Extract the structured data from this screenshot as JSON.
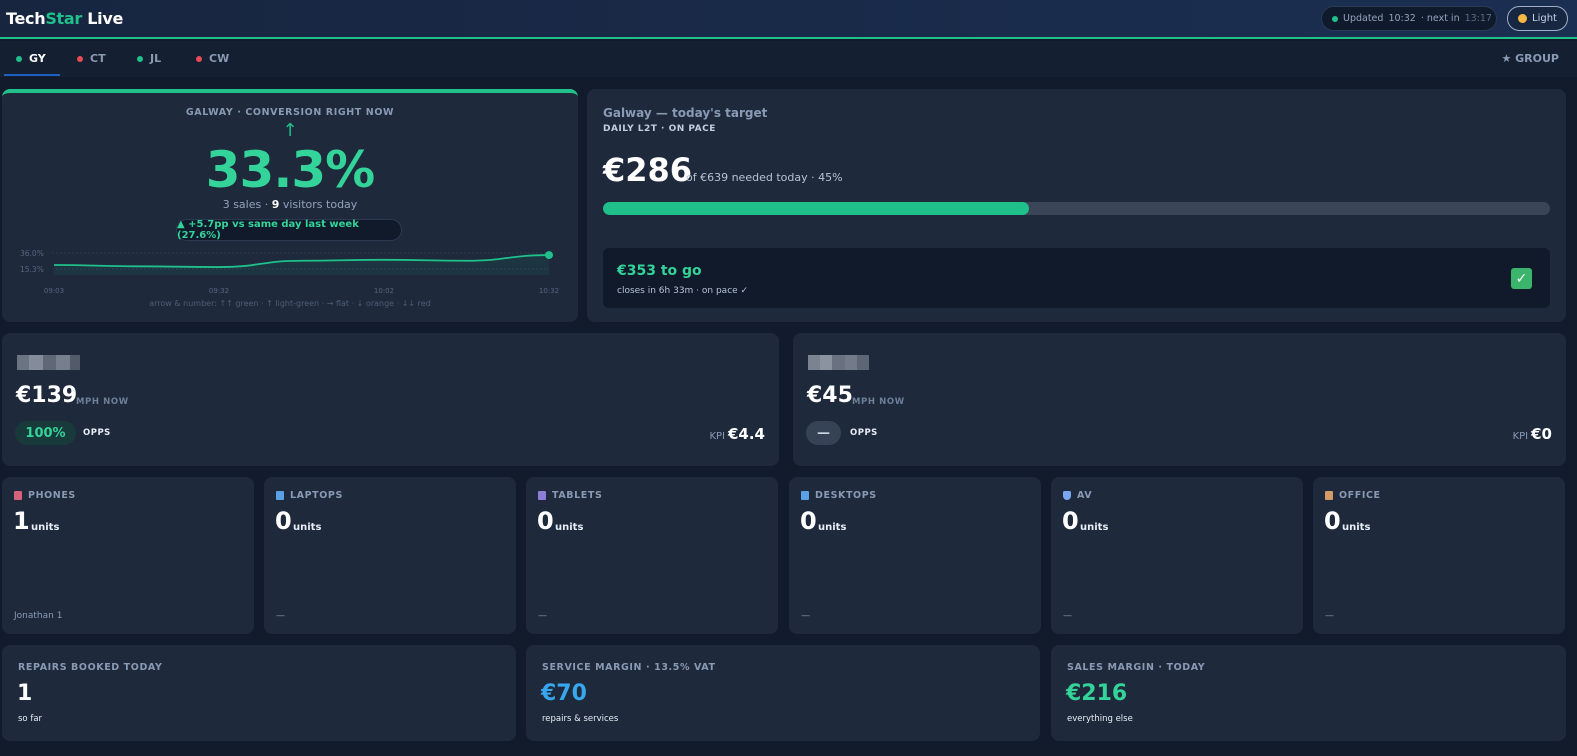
{
  "header": {
    "brand_part1": "Tech",
    "brand_part2": "Star",
    "brand_part3": " Live",
    "updated_label": "Updated",
    "updated_time": "10:32",
    "next_label": "· next in",
    "next_time": "13:17",
    "theme_label": "Light"
  },
  "tabs": [
    {
      "label": "GY",
      "status": "green"
    },
    {
      "label": "CT",
      "status": "red"
    },
    {
      "label": "JL",
      "status": "green"
    },
    {
      "label": "CW",
      "status": "red"
    }
  ],
  "group_label": "★ GROUP",
  "conversion": {
    "title": "GALWAY · CONVERSION RIGHT NOW",
    "arrow": "↑",
    "value": "33.3%",
    "sales": "3 sales ·",
    "visitors": "9",
    "visitors_label": "visitors today",
    "delta": "▲ +5.7pp vs same day last week (27.6%)",
    "y_max_label": "36.0%",
    "y_min_label": "15.3%",
    "x_labels": [
      "09:03",
      "09:32",
      "10:02",
      "10:32"
    ],
    "legend": "arrow & number: ↑↑ green · ↑ light-green · → flat · ↓ orange · ↓↓ red",
    "series": [
      {
        "time": "09:03",
        "value": 20.5
      },
      {
        "time": "09:18",
        "value": 18.8
      },
      {
        "time": "09:32",
        "value": 17.8
      },
      {
        "time": "09:47",
        "value": 26.0
      },
      {
        "time": "10:02",
        "value": 27.2
      },
      {
        "time": "10:17",
        "value": 26.0
      },
      {
        "time": "10:32",
        "value": 33.3
      }
    ],
    "y_range": [
      15.3,
      36.0
    ]
  },
  "target": {
    "title": "Galway — today's target",
    "subtitle": "DAILY L2T · ON PACE",
    "amount": "€286",
    "amount_sub": "of €639 needed today · 45%",
    "progress_pct": 45,
    "to_go": "€353 to go",
    "closes": "closes in 6h 33m · on pace ✓",
    "check": "✓"
  },
  "staff": [
    {
      "mph": "€139",
      "mph_label": "MPH NOW",
      "opps": "100%",
      "opps_label": "OPPS",
      "kpi_label": "KPI",
      "kpi_value": "€4.4"
    },
    {
      "mph": "€45",
      "mph_label": "MPH NOW",
      "opps": "—",
      "opps_label": "OPPS",
      "kpi_label": "KPI",
      "kpi_value": "€0"
    }
  ],
  "categories": [
    {
      "title": "PHONES",
      "value": "1",
      "unit": "units",
      "footer": "Jonathan 1",
      "icon": "phone-icon",
      "icon_color": "#d6637a"
    },
    {
      "title": "LAPTOPS",
      "value": "0",
      "unit": "units",
      "footer": "—",
      "icon": "laptop-icon",
      "icon_color": "#5aa0e6"
    },
    {
      "title": "TABLETS",
      "value": "0",
      "unit": "units",
      "footer": "—",
      "icon": "tablet-icon",
      "icon_color": "#8f7bd8"
    },
    {
      "title": "DESKTOPS",
      "value": "0",
      "unit": "units",
      "footer": "—",
      "icon": "desktop-icon",
      "icon_color": "#5aa0e6"
    },
    {
      "title": "AV",
      "value": "0",
      "unit": "units",
      "footer": "—",
      "icon": "shield-icon",
      "icon_color": "#7aa8f0"
    },
    {
      "title": "OFFICE",
      "value": "0",
      "unit": "units",
      "footer": "—",
      "icon": "box-icon",
      "icon_color": "#d39b6a"
    }
  ],
  "bottom": [
    {
      "title": "REPAIRS BOOKED TODAY",
      "value": "1",
      "sub": "so far",
      "color": "#ffffff"
    },
    {
      "title": "SERVICE MARGIN · 13.5% VAT",
      "value": "€70",
      "sub": "repairs & services",
      "color": "#38a8ee"
    },
    {
      "title": "SALES MARGIN · TODAY",
      "value": "€216",
      "sub": "everything else",
      "color": "#34d399"
    }
  ],
  "colors": {
    "accent": "#1fc08a",
    "good": "#34d399",
    "bad": "#e84b55",
    "blue": "#38a8ee"
  }
}
